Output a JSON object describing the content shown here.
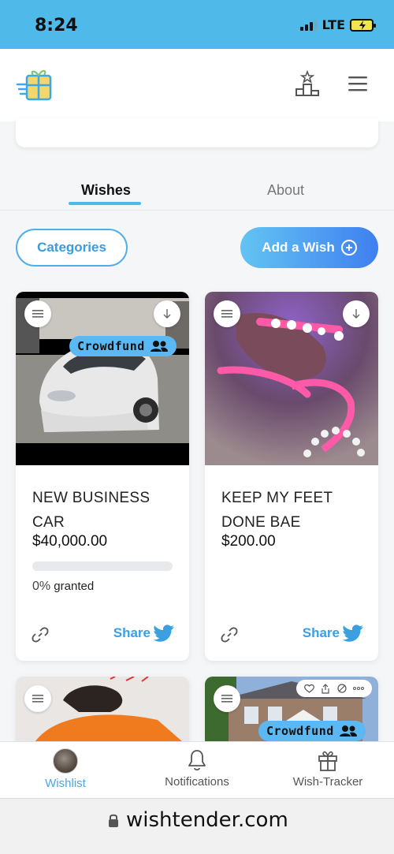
{
  "status_bar": {
    "time": "8:24",
    "network": "LTE"
  },
  "tabs": [
    {
      "label": "Wishes",
      "active": true
    },
    {
      "label": "About",
      "active": false
    }
  ],
  "actions": {
    "categories_label": "Categories",
    "add_wish_label": "Add a Wish"
  },
  "wishes": [
    {
      "title": "NEW BUSINESS CAR",
      "price": "$40,000.00",
      "badge": "Crowdfund",
      "progress_percent": 0,
      "progress_pct_label": "0%",
      "progress_suffix": "granted",
      "share_label": "Share"
    },
    {
      "title": "KEEP MY FEET DONE BAE",
      "price": "$200.00",
      "share_label": "Share"
    },
    {},
    {
      "badge": "Crowdfund"
    }
  ],
  "bottom_nav": [
    {
      "label": "Wishlist",
      "active": true,
      "icon": "avatar"
    },
    {
      "label": "Notifications",
      "active": false,
      "icon": "bell-icon"
    },
    {
      "label": "Wish-Tracker",
      "active": false,
      "icon": "gift-icon"
    }
  ],
  "browser": {
    "url": "wishtender.com"
  },
  "colors": {
    "accent": "#4fb9ea",
    "button_gradient_start": "#63c4f2",
    "button_gradient_end": "#3f7ff0"
  }
}
